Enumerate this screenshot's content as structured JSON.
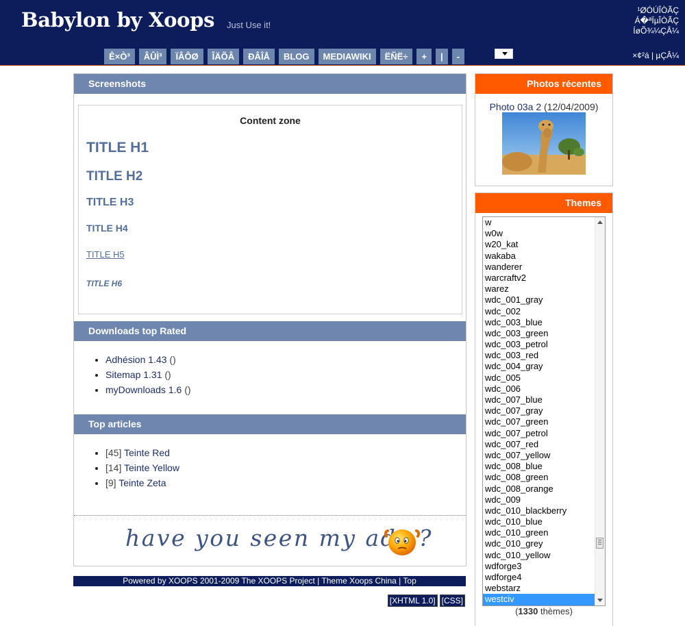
{
  "header": {
    "site_name": "Babylon by Xoops",
    "slogan": "Just Use it!",
    "top_right_lines": [
      "¹ØÓÚÎÒÃÇ",
      "Á�ªÏµÎÒÃÇ",
      "ÍøÕ¾¼ÇÂ¼"
    ],
    "nav": [
      "Ê×Ò³",
      "ÂÛÌ³",
      "ÏÂÔØ",
      "ÎÄÕÂ",
      "ÐÂÎÅ",
      "BLOG",
      "MEDIAWIKI",
      "ËÑË÷",
      "+",
      "|",
      "-"
    ],
    "nav_right": "×¢²á | µÇÂ¼"
  },
  "main": {
    "screenshots_title": "Screenshots",
    "content_zone_title": "Content zone",
    "headings": [
      "TITLE H1",
      "TITLE H2",
      "TITLE H3",
      "TITLE H4",
      "TITLE H5",
      "TITLE H6"
    ],
    "downloads_title": "Downloads top Rated",
    "downloads": [
      {
        "name": "Adhésion",
        "version": "1.43",
        "extra": "()"
      },
      {
        "name": "Sitemap",
        "version": "1.31",
        "extra": "()"
      },
      {
        "name": "myDownloads",
        "version": "1.6",
        "extra": "()"
      }
    ],
    "articles_title": "Top articles",
    "articles": [
      {
        "count": "[45]",
        "name": "Teinte Red"
      },
      {
        "count": "[14]",
        "name": "Teinte Yellow"
      },
      {
        "count": "[9]",
        "name": "Teinte Zeta"
      }
    ],
    "ads_text": "have you seen my ads ?"
  },
  "footer": {
    "powered": "Powered by XOOPS 2001-2009 The XOOPS Project",
    "sep": " | ",
    "theme_credit": "Theme Xoops China",
    "top": "Top",
    "xhtml": "[XHTML 1.0]",
    "css": "[CSS]"
  },
  "sidebar": {
    "photos_title": "Photos récentes",
    "photo_caption": "Photo 03a 2",
    "photo_date": "(12/04/2009)",
    "themes_title": "Themes",
    "themes": [
      "w",
      "w0w",
      "w20_kat",
      "wakaba",
      "wanderer",
      "warcraftv2",
      "warez",
      "wdc_001_gray",
      "wdc_002",
      "wdc_003_blue",
      "wdc_003_green",
      "wdc_003_petrol",
      "wdc_003_red",
      "wdc_004_gray",
      "wdc_005",
      "wdc_006",
      "wdc_007_blue",
      "wdc_007_gray",
      "wdc_007_green",
      "wdc_007_petrol",
      "wdc_007_red",
      "wdc_007_yellow",
      "wdc_008_blue",
      "wdc_008_green",
      "wdc_008_orange",
      "wdc_009",
      "wdc_010_blackberry",
      "wdc_010_blue",
      "wdc_010_green",
      "wdc_010_grey",
      "wdc_010_yellow",
      "wdforge3",
      "wdforge4",
      "webstarz",
      "westciv"
    ],
    "selected_theme": "westciv",
    "themes_count": "1330",
    "themes_count_label": "thèmes"
  },
  "colors": {
    "header_bg": "#0d1d5b",
    "block_title_bg": "#6f87ae",
    "side_title_bg": "#ff5a00",
    "selected_bg": "#3399ff"
  }
}
